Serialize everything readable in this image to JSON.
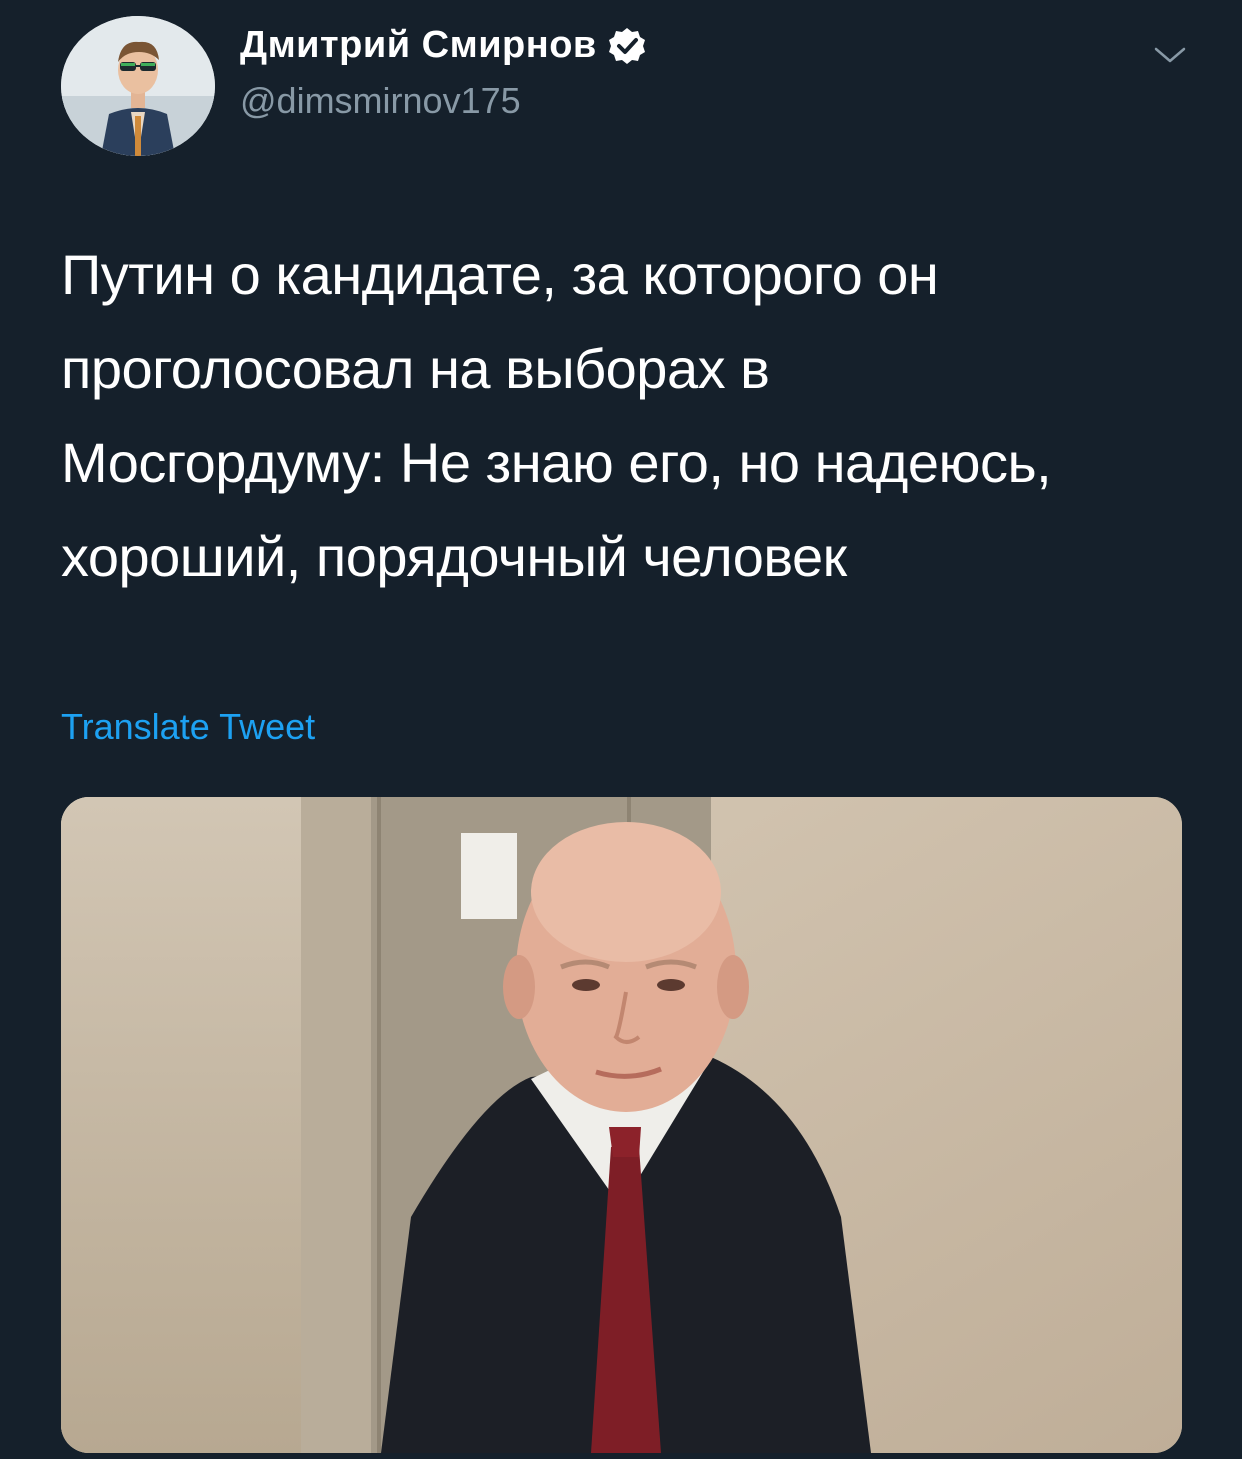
{
  "author": {
    "display_name": "Дмитрий Смирнов",
    "handle": "@dimsmirnov175",
    "verified": true,
    "avatar_icon": "user-photo"
  },
  "tweet": {
    "text": "Путин о кандидате, за которого он\nпроголосовал на выборах в\nМосгордуму: Не знаю его, но надеюсь,\nхороший, порядочный человек",
    "translate_label": "Translate Tweet"
  },
  "colors": {
    "background": "#15202b",
    "primary_text": "#ffffff",
    "secondary_text": "#8899a6",
    "link": "#1da1f2"
  }
}
